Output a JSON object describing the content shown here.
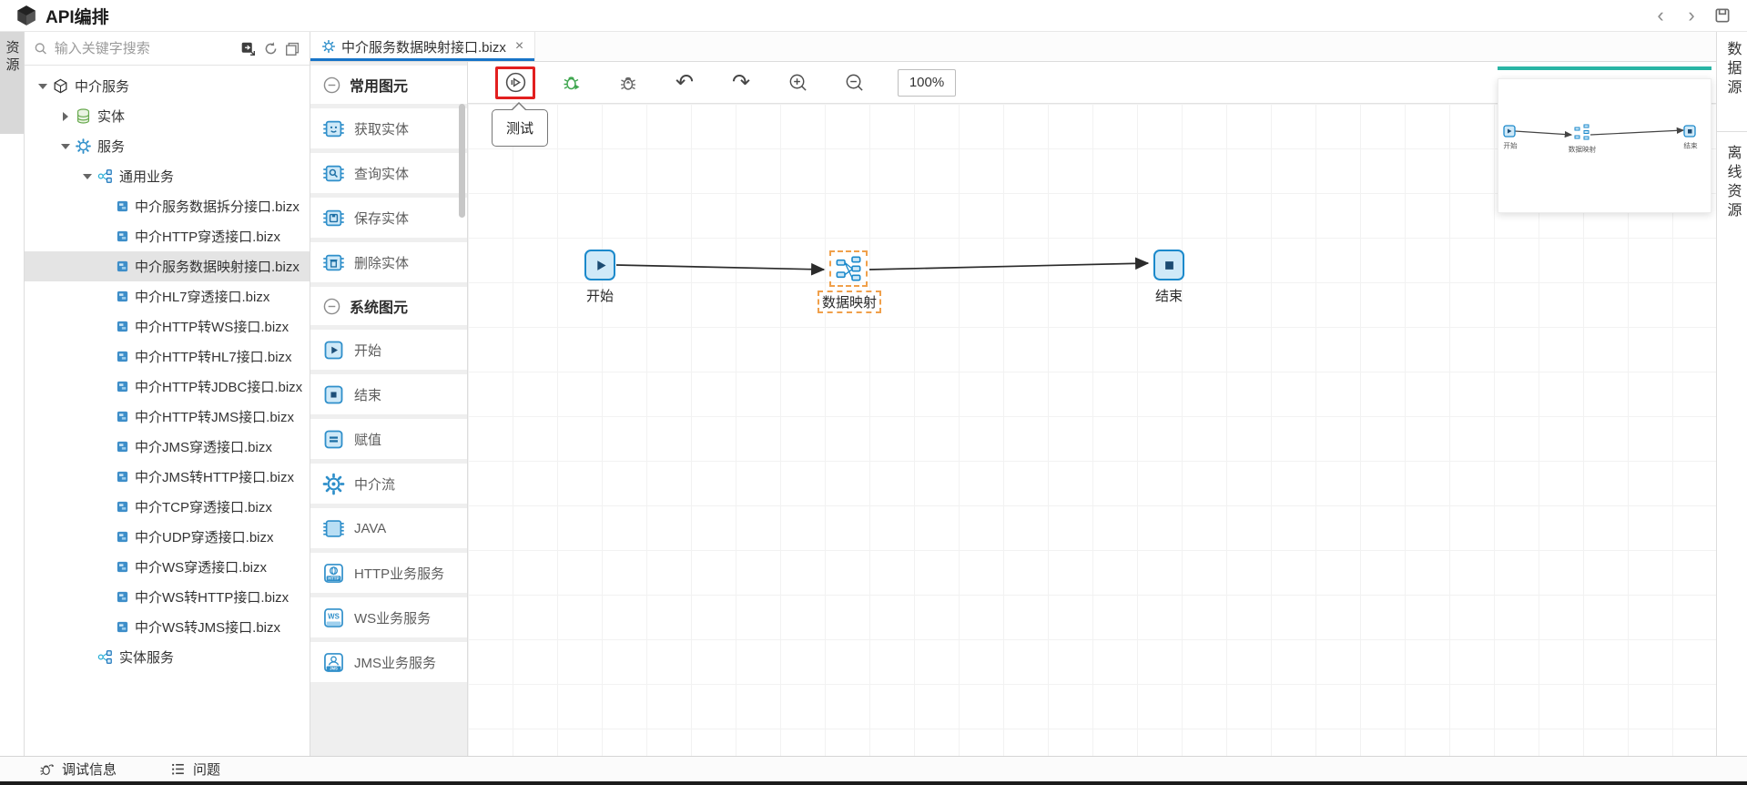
{
  "app": {
    "title": "API编排"
  },
  "window_nav": {
    "back": "‹",
    "forward": "›",
    "save_icon": "floppy-disk"
  },
  "left_rail": {
    "tab": "资源"
  },
  "sidebar": {
    "search": {
      "placeholder": "输入关键字搜索",
      "icons": [
        "locate-icon",
        "refresh-icon",
        "collapse-panels-icon"
      ]
    },
    "tree": {
      "root": "中介服务",
      "entity": "实体",
      "service": "服务",
      "business": "通用业务",
      "entity_service": "实体服务",
      "files": [
        {
          "label": "中介服务数据拆分接口.bizx"
        },
        {
          "label": "中介HTTP穿透接口.bizx"
        },
        {
          "label": "中介服务数据映射接口.bizx",
          "selected": true
        },
        {
          "label": "中介HL7穿透接口.bizx"
        },
        {
          "label": "中介HTTP转WS接口.bizx"
        },
        {
          "label": "中介HTTP转HL7接口.bizx"
        },
        {
          "label": "中介HTTP转JDBC接口.bizx"
        },
        {
          "label": "中介HTTP转JMS接口.bizx"
        },
        {
          "label": "中介JMS穿透接口.bizx"
        },
        {
          "label": "中介JMS转HTTP接口.bizx"
        },
        {
          "label": "中介TCP穿透接口.bizx"
        },
        {
          "label": "中介UDP穿透接口.bizx"
        },
        {
          "label": "中介WS穿透接口.bizx"
        },
        {
          "label": "中介WS转HTTP接口.bizx"
        },
        {
          "label": "中介WS转JMS接口.bizx"
        }
      ]
    }
  },
  "tabs": [
    {
      "label": "中介服务数据映射接口.bizx",
      "close": "×",
      "active": true
    }
  ],
  "palette": {
    "groups": [
      {
        "title": "常用图元",
        "items": [
          "获取实体",
          "查询实体",
          "保存实体",
          "删除实体"
        ]
      },
      {
        "title": "系统图元",
        "items": [
          "开始",
          "结束",
          "赋值",
          "中介流",
          "JAVA",
          "HTTP业务服务",
          "WS业务服务",
          "JMS业务服务"
        ]
      }
    ]
  },
  "toolbar": {
    "buttons": [
      "test",
      "debug-run",
      "debug-step",
      "undo",
      "redo",
      "zoom-in",
      "zoom-out"
    ],
    "highlighted_button": "test",
    "tooltip": "测试",
    "zoom_level": "100%",
    "undo_glyph": "↶",
    "redo_glyph": "↷"
  },
  "canvas": {
    "nodes": [
      {
        "id": "start",
        "label": "开始"
      },
      {
        "id": "data-mapping",
        "label": "数据映射",
        "selected": true
      },
      {
        "id": "end",
        "label": "结束"
      }
    ],
    "edges": [
      {
        "from": "开始",
        "to": "数据映射"
      },
      {
        "from": "数据映射",
        "to": "结束"
      }
    ]
  },
  "right_rail": {
    "tabs": [
      "数据源",
      "离线资源"
    ]
  },
  "bottom_bar": {
    "items": [
      "调试信息",
      "问题"
    ]
  },
  "colors": {
    "accent": "#1b89cb",
    "tab_underline": "#1774c8",
    "teal": "#2ab5a5",
    "highlight_red": "#e21f1f",
    "selection_orange": "#f0a04b",
    "node_fill": "#cfe9f8"
  }
}
